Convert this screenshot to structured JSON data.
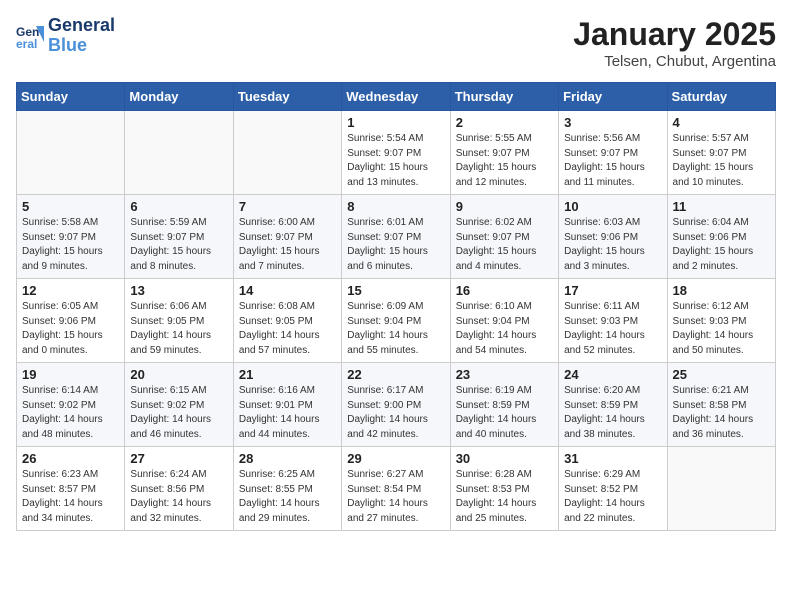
{
  "logo": {
    "line1": "General",
    "line2": "Blue"
  },
  "title": "January 2025",
  "location": "Telsen, Chubut, Argentina",
  "weekdays": [
    "Sunday",
    "Monday",
    "Tuesday",
    "Wednesday",
    "Thursday",
    "Friday",
    "Saturday"
  ],
  "weeks": [
    [
      {
        "day": "",
        "content": ""
      },
      {
        "day": "",
        "content": ""
      },
      {
        "day": "",
        "content": ""
      },
      {
        "day": "1",
        "content": "Sunrise: 5:54 AM\nSunset: 9:07 PM\nDaylight: 15 hours\nand 13 minutes."
      },
      {
        "day": "2",
        "content": "Sunrise: 5:55 AM\nSunset: 9:07 PM\nDaylight: 15 hours\nand 12 minutes."
      },
      {
        "day": "3",
        "content": "Sunrise: 5:56 AM\nSunset: 9:07 PM\nDaylight: 15 hours\nand 11 minutes."
      },
      {
        "day": "4",
        "content": "Sunrise: 5:57 AM\nSunset: 9:07 PM\nDaylight: 15 hours\nand 10 minutes."
      }
    ],
    [
      {
        "day": "5",
        "content": "Sunrise: 5:58 AM\nSunset: 9:07 PM\nDaylight: 15 hours\nand 9 minutes."
      },
      {
        "day": "6",
        "content": "Sunrise: 5:59 AM\nSunset: 9:07 PM\nDaylight: 15 hours\nand 8 minutes."
      },
      {
        "day": "7",
        "content": "Sunrise: 6:00 AM\nSunset: 9:07 PM\nDaylight: 15 hours\nand 7 minutes."
      },
      {
        "day": "8",
        "content": "Sunrise: 6:01 AM\nSunset: 9:07 PM\nDaylight: 15 hours\nand 6 minutes."
      },
      {
        "day": "9",
        "content": "Sunrise: 6:02 AM\nSunset: 9:07 PM\nDaylight: 15 hours\nand 4 minutes."
      },
      {
        "day": "10",
        "content": "Sunrise: 6:03 AM\nSunset: 9:06 PM\nDaylight: 15 hours\nand 3 minutes."
      },
      {
        "day": "11",
        "content": "Sunrise: 6:04 AM\nSunset: 9:06 PM\nDaylight: 15 hours\nand 2 minutes."
      }
    ],
    [
      {
        "day": "12",
        "content": "Sunrise: 6:05 AM\nSunset: 9:06 PM\nDaylight: 15 hours\nand 0 minutes."
      },
      {
        "day": "13",
        "content": "Sunrise: 6:06 AM\nSunset: 9:05 PM\nDaylight: 14 hours\nand 59 minutes."
      },
      {
        "day": "14",
        "content": "Sunrise: 6:08 AM\nSunset: 9:05 PM\nDaylight: 14 hours\nand 57 minutes."
      },
      {
        "day": "15",
        "content": "Sunrise: 6:09 AM\nSunset: 9:04 PM\nDaylight: 14 hours\nand 55 minutes."
      },
      {
        "day": "16",
        "content": "Sunrise: 6:10 AM\nSunset: 9:04 PM\nDaylight: 14 hours\nand 54 minutes."
      },
      {
        "day": "17",
        "content": "Sunrise: 6:11 AM\nSunset: 9:03 PM\nDaylight: 14 hours\nand 52 minutes."
      },
      {
        "day": "18",
        "content": "Sunrise: 6:12 AM\nSunset: 9:03 PM\nDaylight: 14 hours\nand 50 minutes."
      }
    ],
    [
      {
        "day": "19",
        "content": "Sunrise: 6:14 AM\nSunset: 9:02 PM\nDaylight: 14 hours\nand 48 minutes."
      },
      {
        "day": "20",
        "content": "Sunrise: 6:15 AM\nSunset: 9:02 PM\nDaylight: 14 hours\nand 46 minutes."
      },
      {
        "day": "21",
        "content": "Sunrise: 6:16 AM\nSunset: 9:01 PM\nDaylight: 14 hours\nand 44 minutes."
      },
      {
        "day": "22",
        "content": "Sunrise: 6:17 AM\nSunset: 9:00 PM\nDaylight: 14 hours\nand 42 minutes."
      },
      {
        "day": "23",
        "content": "Sunrise: 6:19 AM\nSunset: 8:59 PM\nDaylight: 14 hours\nand 40 minutes."
      },
      {
        "day": "24",
        "content": "Sunrise: 6:20 AM\nSunset: 8:59 PM\nDaylight: 14 hours\nand 38 minutes."
      },
      {
        "day": "25",
        "content": "Sunrise: 6:21 AM\nSunset: 8:58 PM\nDaylight: 14 hours\nand 36 minutes."
      }
    ],
    [
      {
        "day": "26",
        "content": "Sunrise: 6:23 AM\nSunset: 8:57 PM\nDaylight: 14 hours\nand 34 minutes."
      },
      {
        "day": "27",
        "content": "Sunrise: 6:24 AM\nSunset: 8:56 PM\nDaylight: 14 hours\nand 32 minutes."
      },
      {
        "day": "28",
        "content": "Sunrise: 6:25 AM\nSunset: 8:55 PM\nDaylight: 14 hours\nand 29 minutes."
      },
      {
        "day": "29",
        "content": "Sunrise: 6:27 AM\nSunset: 8:54 PM\nDaylight: 14 hours\nand 27 minutes."
      },
      {
        "day": "30",
        "content": "Sunrise: 6:28 AM\nSunset: 8:53 PM\nDaylight: 14 hours\nand 25 minutes."
      },
      {
        "day": "31",
        "content": "Sunrise: 6:29 AM\nSunset: 8:52 PM\nDaylight: 14 hours\nand 22 minutes."
      },
      {
        "day": "",
        "content": ""
      }
    ]
  ]
}
